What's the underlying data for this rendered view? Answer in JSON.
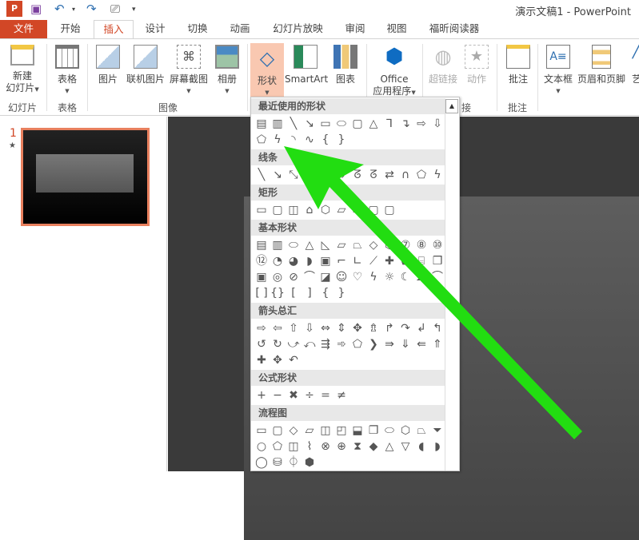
{
  "window": {
    "title": "演示文稿1 - PowerPoint"
  },
  "qat": {
    "app_icon": "powerpoint-icon",
    "save": "save-icon",
    "undo": "undo-icon",
    "redo": "redo-icon",
    "present": "start-from-beginning-icon",
    "customize": "customize-qat-icon"
  },
  "tabs": [
    "文件",
    "开始",
    "插入",
    "设计",
    "切换",
    "动画",
    "幻灯片放映",
    "审阅",
    "视图",
    "福昕阅读器"
  ],
  "active_tab": "插入",
  "ribbon": {
    "buttons": {
      "new_slide": "新建",
      "new_slide2": "幻灯片",
      "table": "表格",
      "picture": "图片",
      "online_picture": "联机图片",
      "screenshot": "屏幕截图",
      "album": "相册",
      "shapes": "形状",
      "smartart": "SmartArt",
      "chart": "图表",
      "office": "Office",
      "office2": "应用程序",
      "hyperlink": "超链接",
      "action": "动作",
      "comment": "批注",
      "textbox": "文本框",
      "header_footer": "页眉和页脚",
      "wordart": "艺"
    },
    "groups": {
      "slides": "幻灯片",
      "tables": "表格",
      "images": "图像",
      "links": "接",
      "comments": "批注"
    }
  },
  "slides": {
    "number": "1",
    "star": "★"
  },
  "shapes_panel": {
    "sections": [
      {
        "title": "最近使用的形状",
        "shapes": [
          "▤",
          "▥",
          "╲",
          "↘",
          "▭",
          "⬭",
          "▢",
          "△",
          "⅂",
          "↴",
          "⇨",
          "⇩",
          "⬠",
          "ϟ",
          "◝",
          "∿",
          "{",
          "}"
        ]
      },
      {
        "title": "线条",
        "shapes": [
          "╲",
          "↘",
          "⤡",
          "⅂",
          "↴",
          "⤷",
          "ᘔ",
          "ᘔ",
          "⇄",
          "∩",
          "⬠",
          "ϟ"
        ]
      },
      {
        "title": "矩形",
        "shapes": [
          "▭",
          "▢",
          "◫",
          "⌂",
          "⬡",
          "▱",
          "▭",
          "▢",
          "▢"
        ]
      },
      {
        "title": "基本形状",
        "shapes": [
          "▤",
          "▥",
          "⬭",
          "△",
          "◺",
          "▱",
          "⏢",
          "◇",
          "⬡",
          "⑦",
          "⑧",
          "⑩",
          "⑫",
          "◔",
          "◕",
          "◗",
          "▣",
          "⌐",
          "∟",
          "⟋",
          "✚",
          "⬟",
          "⌸",
          "❒",
          "▣",
          "◎",
          "⊘",
          "⌒",
          "◪",
          "☺",
          "♡",
          "ϟ",
          "☼",
          "☾",
          "☁",
          "⌒",
          "[ ]",
          "{}",
          "[",
          "]",
          "{",
          "}"
        ]
      },
      {
        "title": "箭头总汇",
        "shapes": [
          "⇨",
          "⇦",
          "⇧",
          "⇩",
          "⇔",
          "⇕",
          "✥",
          "⇯",
          "↱",
          "↷",
          "↲",
          "↰",
          "↺",
          "↻",
          "⤻",
          "⤺",
          "⇶",
          "➾",
          "⬠",
          "❯",
          "⇛",
          "⇓",
          "⇚",
          "⇑",
          "✚",
          "✥",
          "↶"
        ]
      },
      {
        "title": "公式形状",
        "shapes": [
          "+",
          "−",
          "✖",
          "÷",
          "=",
          "≠"
        ]
      },
      {
        "title": "流程图",
        "shapes": [
          "▭",
          "▢",
          "◇",
          "▱",
          "◫",
          "◰",
          "⬓",
          "❐",
          "⬭",
          "⬡",
          "⏢",
          "⏷",
          "○",
          "⬠",
          "◫",
          "⌇",
          "⊗",
          "⊕",
          "⧗",
          "◆",
          "△",
          "▽",
          "◖",
          "◗",
          "◯",
          "⛁",
          "⏀",
          "⬢"
        ]
      }
    ],
    "scroll_up": "▲"
  },
  "annotation": {
    "arrow_color": "#22dd11"
  },
  "colors": {
    "accent": "#d24726",
    "shapes_highlight": "#f9c8b1"
  }
}
